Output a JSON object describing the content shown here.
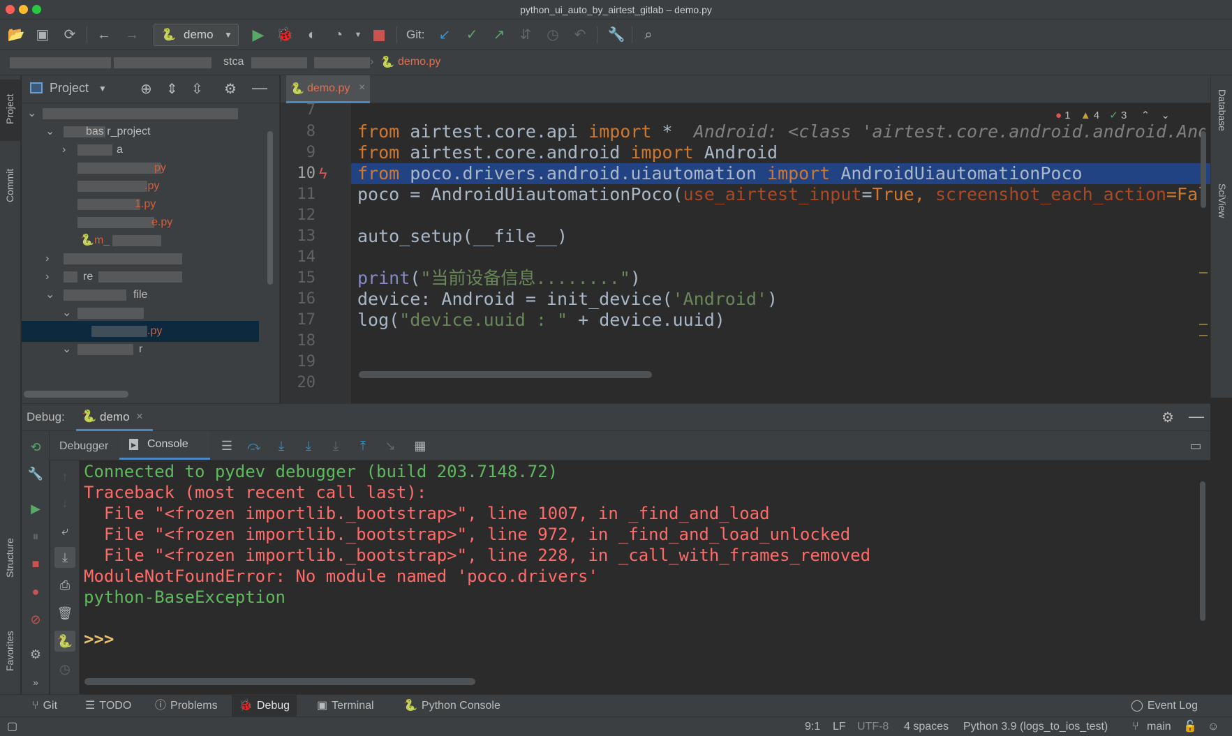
{
  "window": {
    "title": "python_ui_auto_by_airtest_gitlab – demo.py"
  },
  "toolbar": {
    "run_config": "demo",
    "git_label": "Git:"
  },
  "breadcrumb": {
    "partial": "stca",
    "file": "demo.py"
  },
  "left_stripe": {
    "project": "Project",
    "commit": "Commit",
    "structure": "Structure",
    "favorites": "Favorites"
  },
  "right_stripe": {
    "database": "Database",
    "sciview": "SciView"
  },
  "project_panel": {
    "title": "Project",
    "rows": [
      {
        "text": ""
      },
      {
        "text": "bas  r_project"
      },
      {
        "text": "a"
      },
      {
        "text": "py"
      },
      {
        "text": ".py"
      },
      {
        "text": "1.py"
      },
      {
        "text": "e.py"
      },
      {
        "text": "m_"
      },
      {
        "text": ""
      },
      {
        "text": "re"
      },
      {
        "text": "file"
      },
      {
        "text": ""
      },
      {
        "text": ".py"
      },
      {
        "text": "r"
      }
    ]
  },
  "editor": {
    "tab": "demo.py",
    "inspections": {
      "errors": "1",
      "warnings": "4",
      "ok": "3"
    },
    "line_numbers": [
      "7",
      "8",
      "9",
      "10",
      "11",
      "12",
      "13",
      "14",
      "15",
      "16",
      "17",
      "18",
      "19",
      "20"
    ],
    "code": {
      "l8_a": "from",
      "l8_b": " airtest.core.api ",
      "l8_c": "import",
      "l8_d": " *  ",
      "l8_hint": "Android: <class 'airtest.core.android.android.And",
      "l9_a": "from",
      "l9_b": " airtest.core.android ",
      "l9_c": "import",
      "l9_d": " Android",
      "l10_a": "from",
      "l10_b": " poco.drivers.android.uiautomation ",
      "l10_c": "import",
      "l10_d": " AndroidUiautomationPoco",
      "l11_a": "poco = AndroidUiautomationPoco(",
      "l11_b": "use_airtest_input",
      "l11_c": "=",
      "l11_d": "True",
      "l11_e": ", ",
      "l11_f": "screenshot_each_action",
      "l11_g": "=Fals",
      "l13": "auto_setup(__file__)",
      "l15_a": "print",
      "l15_b": "(",
      "l15_c": "\"当前设备信息........\"",
      "l15_d": ")",
      "l16_a": "device: Android = init_device(",
      "l16_b": "'Android'",
      "l16_c": ")",
      "l17_a": "log(",
      "l17_b": "\"device.uuid : \"",
      "l17_c": " + device.uuid)"
    }
  },
  "debug": {
    "label": "Debug:",
    "session": "demo",
    "tab_debugger": "Debugger",
    "tab_console": "Console",
    "console_lines": [
      {
        "text": "Connected to pydev debugger (build 203.7148.72)",
        "color": "#5fb95f"
      },
      {
        "text": "Traceback (most recent call last):",
        "color": "#ff6b68"
      },
      {
        "text": "  File \"<frozen importlib._bootstrap>\", line 1007, in _find_and_load",
        "color": "#ff6b68"
      },
      {
        "text": "  File \"<frozen importlib._bootstrap>\", line 972, in _find_and_load_unlocked",
        "color": "#ff6b68"
      },
      {
        "text": "  File \"<frozen importlib._bootstrap>\", line 228, in _call_with_frames_removed",
        "color": "#ff6b68"
      },
      {
        "text": "ModuleNotFoundError: No module named 'poco.drivers'",
        "color": "#ff6b68"
      },
      {
        "text": "python-BaseException",
        "color": "#5fb95f"
      }
    ],
    "prompt": ">>>"
  },
  "bottom_tabs": {
    "git": "Git",
    "todo": "TODO",
    "problems": "Problems",
    "debug": "Debug",
    "terminal": "Terminal",
    "python_console": "Python Console",
    "event_log": "Event Log"
  },
  "status": {
    "position": "9:1",
    "line_sep": "LF",
    "encoding": "UTF-8",
    "indent": "4 spaces",
    "interpreter": "Python 3.9 (logs_to_ios_test)",
    "branch": "main"
  },
  "colors": {
    "accent": "#4a88c7",
    "selection": "#214283",
    "error": "#ff6b68",
    "success": "#5fb95f",
    "prompt": "#e8bf6a"
  }
}
